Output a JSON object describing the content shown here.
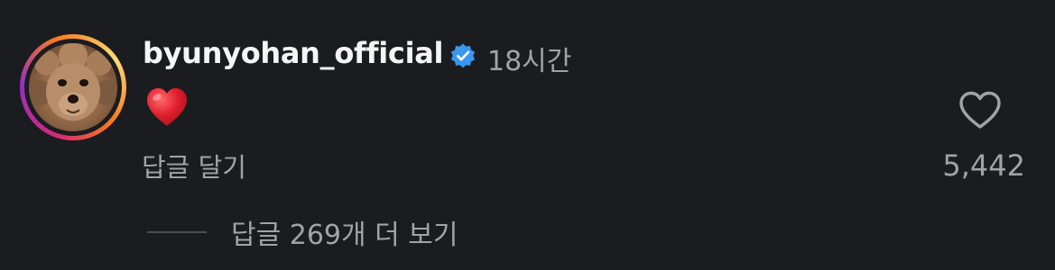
{
  "comment": {
    "username": "byunyohan_official",
    "verified": true,
    "time": "18시간",
    "body_icon": "red-heart-emoji",
    "reply_label": "답글 달기",
    "like_icon": "heart-outline-icon",
    "like_count": "5,442",
    "view_replies_label": "답글 269개 더 보기"
  },
  "colors": {
    "background": "#1a1c20",
    "primary_text": "#f5f5f5",
    "secondary_text": "#a0a3a8",
    "verified_blue": "#3897f0",
    "heart_red": "#e0202e"
  }
}
